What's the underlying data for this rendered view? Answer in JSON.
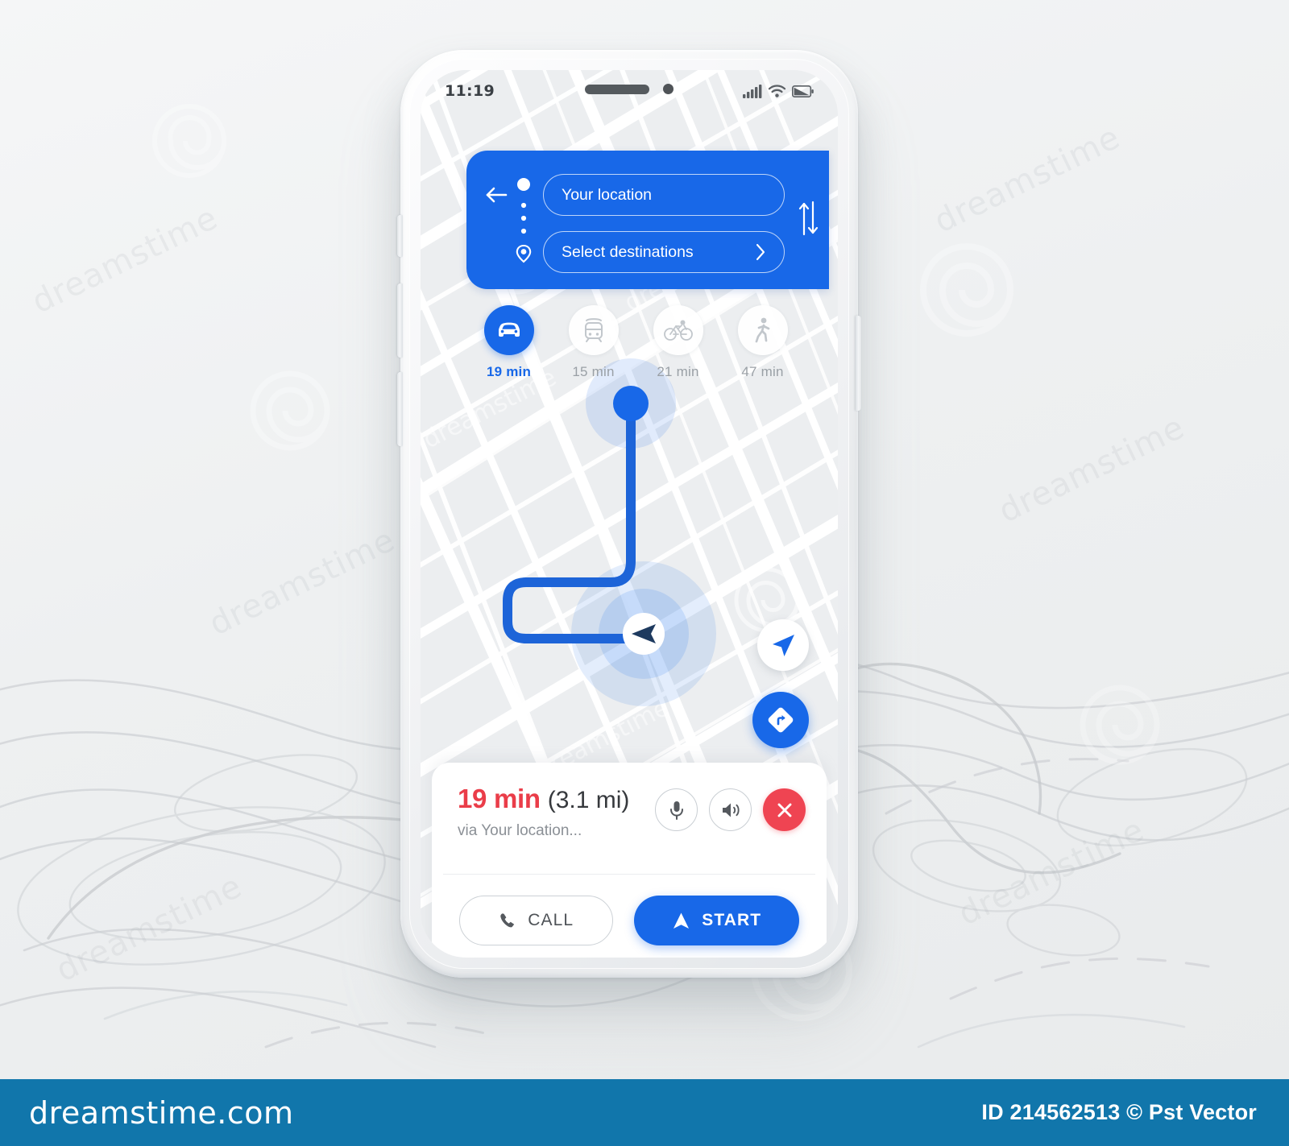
{
  "statusbar": {
    "time": "11:19",
    "icons": [
      "signal-bars-icon",
      "wifi-icon",
      "battery-icon"
    ]
  },
  "search_header": {
    "back_icon": "back-arrow-icon",
    "origin_value": "Your location",
    "destination_value": "Select destinations",
    "destination_chevron": "chevron-right-icon",
    "swap_icon": "swap-vertical-icon",
    "origin_marker_icon": "origin-dot-icon",
    "destination_marker_icon": "map-pin-icon",
    "accent": "#1868e8"
  },
  "modes": [
    {
      "id": "car",
      "icon": "car-icon",
      "label": "19 min",
      "active": true
    },
    {
      "id": "transit",
      "icon": "tram-icon",
      "label": "15 min",
      "active": false
    },
    {
      "id": "bike",
      "icon": "bicycle-icon",
      "label": "21 min",
      "active": false
    },
    {
      "id": "walk",
      "icon": "walk-icon",
      "label": "47 min",
      "active": false
    }
  ],
  "map": {
    "locate_icon": "navigation-arrow-icon",
    "directions_icon": "directions-sign-icon",
    "origin_marker": "route-start-dot",
    "vehicle_marker": "vehicle-heading-arrow",
    "route_color": "#1d64d8"
  },
  "info_card": {
    "eta_time": "19 min",
    "eta_distance": "(3.1 mi)",
    "via_text": "via Your location...",
    "eta_time_color": "#ea3d49",
    "mic_icon": "microphone-icon",
    "volume_icon": "speaker-volume-icon",
    "close_icon": "close-x-icon",
    "call_label": "CALL",
    "call_icon": "phone-icon",
    "start_label": "START",
    "start_icon": "navigation-arrow-icon"
  },
  "footer": {
    "logo": "dreamstime.com",
    "credit": "ID 214562513 © Pst Vector",
    "background": "#1176ab"
  }
}
